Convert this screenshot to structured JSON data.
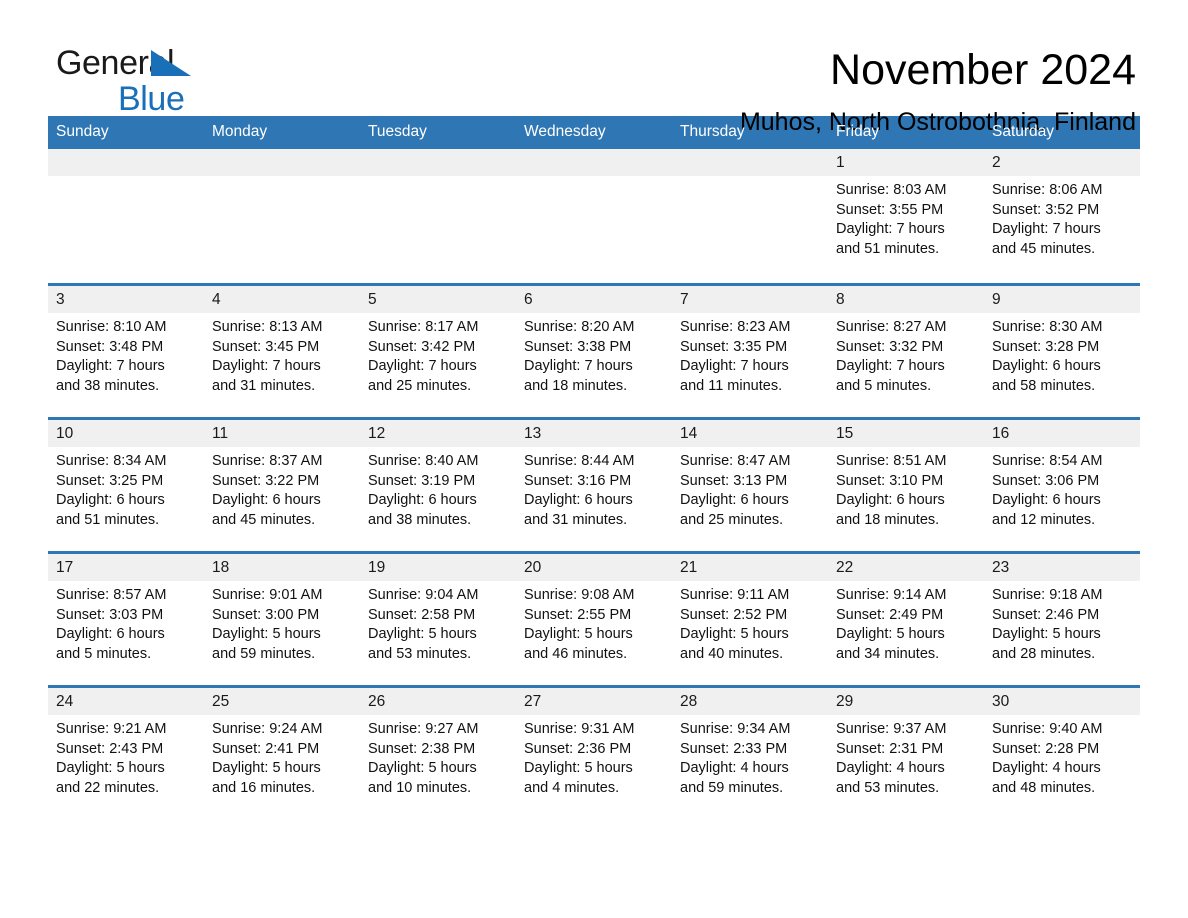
{
  "brand": {
    "name_top": "General",
    "name_bottom": "Blue",
    "accent_color": "#1a70b8"
  },
  "header": {
    "month_title": "November 2024",
    "location": "Muhos, North Ostrobothnia, Finland"
  },
  "calendar": {
    "header_color": "#2e76b4",
    "daynum_band_color": "#f0f0f0",
    "weekday_names": [
      "Sunday",
      "Monday",
      "Tuesday",
      "Wednesday",
      "Thursday",
      "Friday",
      "Saturday"
    ],
    "labels": {
      "sunrise_prefix": "Sunrise:",
      "sunset_prefix": "Sunset:",
      "daylight_prefix": "Daylight:"
    },
    "weeks": [
      [
        {
          "day": "",
          "empty": true
        },
        {
          "day": "",
          "empty": true
        },
        {
          "day": "",
          "empty": true
        },
        {
          "day": "",
          "empty": true
        },
        {
          "day": "",
          "empty": true
        },
        {
          "day": "1",
          "sunrise": "Sunrise: 8:03 AM",
          "sunset": "Sunset: 3:55 PM",
          "daylight_line1": "Daylight: 7 hours",
          "daylight_line2": "and 51 minutes."
        },
        {
          "day": "2",
          "sunrise": "Sunrise: 8:06 AM",
          "sunset": "Sunset: 3:52 PM",
          "daylight_line1": "Daylight: 7 hours",
          "daylight_line2": "and 45 minutes."
        }
      ],
      [
        {
          "day": "3",
          "sunrise": "Sunrise: 8:10 AM",
          "sunset": "Sunset: 3:48 PM",
          "daylight_line1": "Daylight: 7 hours",
          "daylight_line2": "and 38 minutes."
        },
        {
          "day": "4",
          "sunrise": "Sunrise: 8:13 AM",
          "sunset": "Sunset: 3:45 PM",
          "daylight_line1": "Daylight: 7 hours",
          "daylight_line2": "and 31 minutes."
        },
        {
          "day": "5",
          "sunrise": "Sunrise: 8:17 AM",
          "sunset": "Sunset: 3:42 PM",
          "daylight_line1": "Daylight: 7 hours",
          "daylight_line2": "and 25 minutes."
        },
        {
          "day": "6",
          "sunrise": "Sunrise: 8:20 AM",
          "sunset": "Sunset: 3:38 PM",
          "daylight_line1": "Daylight: 7 hours",
          "daylight_line2": "and 18 minutes."
        },
        {
          "day": "7",
          "sunrise": "Sunrise: 8:23 AM",
          "sunset": "Sunset: 3:35 PM",
          "daylight_line1": "Daylight: 7 hours",
          "daylight_line2": "and 11 minutes."
        },
        {
          "day": "8",
          "sunrise": "Sunrise: 8:27 AM",
          "sunset": "Sunset: 3:32 PM",
          "daylight_line1": "Daylight: 7 hours",
          "daylight_line2": "and 5 minutes."
        },
        {
          "day": "9",
          "sunrise": "Sunrise: 8:30 AM",
          "sunset": "Sunset: 3:28 PM",
          "daylight_line1": "Daylight: 6 hours",
          "daylight_line2": "and 58 minutes."
        }
      ],
      [
        {
          "day": "10",
          "sunrise": "Sunrise: 8:34 AM",
          "sunset": "Sunset: 3:25 PM",
          "daylight_line1": "Daylight: 6 hours",
          "daylight_line2": "and 51 minutes."
        },
        {
          "day": "11",
          "sunrise": "Sunrise: 8:37 AM",
          "sunset": "Sunset: 3:22 PM",
          "daylight_line1": "Daylight: 6 hours",
          "daylight_line2": "and 45 minutes."
        },
        {
          "day": "12",
          "sunrise": "Sunrise: 8:40 AM",
          "sunset": "Sunset: 3:19 PM",
          "daylight_line1": "Daylight: 6 hours",
          "daylight_line2": "and 38 minutes."
        },
        {
          "day": "13",
          "sunrise": "Sunrise: 8:44 AM",
          "sunset": "Sunset: 3:16 PM",
          "daylight_line1": "Daylight: 6 hours",
          "daylight_line2": "and 31 minutes."
        },
        {
          "day": "14",
          "sunrise": "Sunrise: 8:47 AM",
          "sunset": "Sunset: 3:13 PM",
          "daylight_line1": "Daylight: 6 hours",
          "daylight_line2": "and 25 minutes."
        },
        {
          "day": "15",
          "sunrise": "Sunrise: 8:51 AM",
          "sunset": "Sunset: 3:10 PM",
          "daylight_line1": "Daylight: 6 hours",
          "daylight_line2": "and 18 minutes."
        },
        {
          "day": "16",
          "sunrise": "Sunrise: 8:54 AM",
          "sunset": "Sunset: 3:06 PM",
          "daylight_line1": "Daylight: 6 hours",
          "daylight_line2": "and 12 minutes."
        }
      ],
      [
        {
          "day": "17",
          "sunrise": "Sunrise: 8:57 AM",
          "sunset": "Sunset: 3:03 PM",
          "daylight_line1": "Daylight: 6 hours",
          "daylight_line2": "and 5 minutes."
        },
        {
          "day": "18",
          "sunrise": "Sunrise: 9:01 AM",
          "sunset": "Sunset: 3:00 PM",
          "daylight_line1": "Daylight: 5 hours",
          "daylight_line2": "and 59 minutes."
        },
        {
          "day": "19",
          "sunrise": "Sunrise: 9:04 AM",
          "sunset": "Sunset: 2:58 PM",
          "daylight_line1": "Daylight: 5 hours",
          "daylight_line2": "and 53 minutes."
        },
        {
          "day": "20",
          "sunrise": "Sunrise: 9:08 AM",
          "sunset": "Sunset: 2:55 PM",
          "daylight_line1": "Daylight: 5 hours",
          "daylight_line2": "and 46 minutes."
        },
        {
          "day": "21",
          "sunrise": "Sunrise: 9:11 AM",
          "sunset": "Sunset: 2:52 PM",
          "daylight_line1": "Daylight: 5 hours",
          "daylight_line2": "and 40 minutes."
        },
        {
          "day": "22",
          "sunrise": "Sunrise: 9:14 AM",
          "sunset": "Sunset: 2:49 PM",
          "daylight_line1": "Daylight: 5 hours",
          "daylight_line2": "and 34 minutes."
        },
        {
          "day": "23",
          "sunrise": "Sunrise: 9:18 AM",
          "sunset": "Sunset: 2:46 PM",
          "daylight_line1": "Daylight: 5 hours",
          "daylight_line2": "and 28 minutes."
        }
      ],
      [
        {
          "day": "24",
          "sunrise": "Sunrise: 9:21 AM",
          "sunset": "Sunset: 2:43 PM",
          "daylight_line1": "Daylight: 5 hours",
          "daylight_line2": "and 22 minutes."
        },
        {
          "day": "25",
          "sunrise": "Sunrise: 9:24 AM",
          "sunset": "Sunset: 2:41 PM",
          "daylight_line1": "Daylight: 5 hours",
          "daylight_line2": "and 16 minutes."
        },
        {
          "day": "26",
          "sunrise": "Sunrise: 9:27 AM",
          "sunset": "Sunset: 2:38 PM",
          "daylight_line1": "Daylight: 5 hours",
          "daylight_line2": "and 10 minutes."
        },
        {
          "day": "27",
          "sunrise": "Sunrise: 9:31 AM",
          "sunset": "Sunset: 2:36 PM",
          "daylight_line1": "Daylight: 5 hours",
          "daylight_line2": "and 4 minutes."
        },
        {
          "day": "28",
          "sunrise": "Sunrise: 9:34 AM",
          "sunset": "Sunset: 2:33 PM",
          "daylight_line1": "Daylight: 4 hours",
          "daylight_line2": "and 59 minutes."
        },
        {
          "day": "29",
          "sunrise": "Sunrise: 9:37 AM",
          "sunset": "Sunset: 2:31 PM",
          "daylight_line1": "Daylight: 4 hours",
          "daylight_line2": "and 53 minutes."
        },
        {
          "day": "30",
          "sunrise": "Sunrise: 9:40 AM",
          "sunset": "Sunset: 2:28 PM",
          "daylight_line1": "Daylight: 4 hours",
          "daylight_line2": "and 48 minutes."
        }
      ]
    ]
  }
}
